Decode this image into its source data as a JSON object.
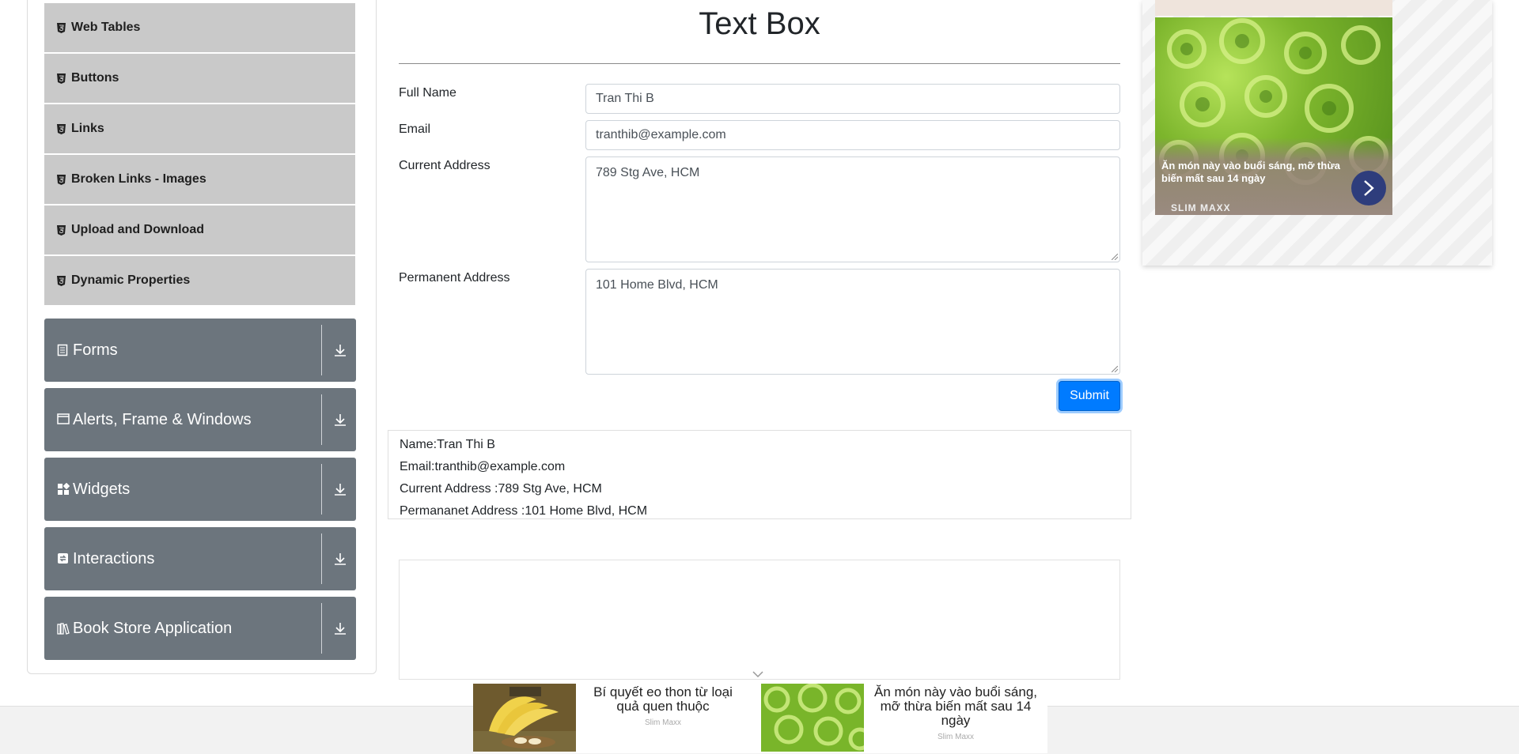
{
  "sidebar": {
    "items": [
      {
        "label": "Web Tables"
      },
      {
        "label": "Buttons"
      },
      {
        "label": "Links"
      },
      {
        "label": "Broken Links - Images"
      },
      {
        "label": "Upload and Download"
      },
      {
        "label": "Dynamic Properties"
      }
    ],
    "groups": [
      {
        "label": "Forms",
        "icon": "form-icon"
      },
      {
        "label": "Alerts, Frame & Windows",
        "icon": "window-icon"
      },
      {
        "label": "Widgets",
        "icon": "widgets-icon"
      },
      {
        "label": "Interactions",
        "icon": "interactions-icon"
      },
      {
        "label": "Book Store Application",
        "icon": "books-icon"
      }
    ]
  },
  "main": {
    "title": "Text Box",
    "fields": {
      "full_name": {
        "label": "Full Name",
        "value": "Tran Thi B"
      },
      "email": {
        "label": "Email",
        "value": "tranthib@example.com"
      },
      "current_address": {
        "label": "Current Address",
        "value": "789 Stg Ave, HCM"
      },
      "permanent_address": {
        "label": "Permanent Address",
        "value": "101 Home Blvd, HCM"
      }
    },
    "submit_label": "Submit",
    "output": {
      "name": "Name:Tran Thi B",
      "email": "Email:tranthib@example.com",
      "current_address": "Current Address :789 Stg Ave, HCM",
      "permanent_address": "Permananet Address :101 Home Blvd, HCM"
    }
  },
  "right_ad": {
    "caption": "Ăn món này vào buổi sáng, mỡ thừa biến mất sau 14 ngày",
    "brand": "SLIM MAXX"
  },
  "bottom_ad": {
    "ad1": {
      "title": "Bí quyết eo thon từ loại quả quen thuộc",
      "brand": "Slim Maxx"
    },
    "ad2": {
      "title": "Ăn món này vào buổi sáng, mỡ thừa biến mất sau 14 ngày",
      "brand": "Slim Maxx"
    }
  },
  "colors": {
    "accent": "#007bff",
    "group_bg": "#6c757d",
    "item_bg": "#c9c9c9"
  }
}
